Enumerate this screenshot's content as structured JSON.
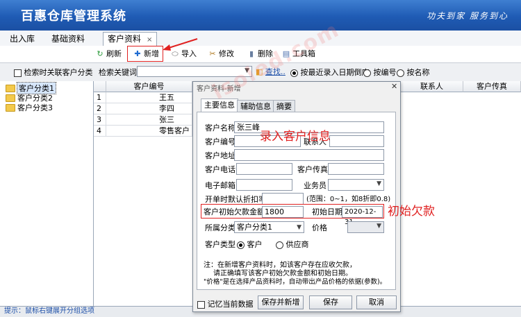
{
  "header": {
    "title": "百惠仓库管理系统",
    "slogan": "功夫到家 服务到心"
  },
  "tabs": [
    {
      "label": "出入库"
    },
    {
      "label": "基础资料"
    },
    {
      "label": "客户资料",
      "close": "×"
    }
  ],
  "toolbar": {
    "refresh": "刷新",
    "add": "新增",
    "import": "导入",
    "edit": "修改",
    "delete": "删除",
    "tools": "工具箱"
  },
  "search": {
    "related_check": "检索时关联客户分类",
    "keyword_label": "检索关键词",
    "keyword_value": "",
    "search_btn": "查找..",
    "sort_recent": "按最近录入日期倒序",
    "sort_code": "按编号",
    "sort_name": "按名称"
  },
  "tree": {
    "items": [
      "客户分类1",
      "客户分类2",
      "客户分类3"
    ]
  },
  "grid": {
    "headers": [
      "客户编号",
      "联系人",
      "客户传真"
    ],
    "rows": [
      {
        "num": "1",
        "name": "王五"
      },
      {
        "num": "2",
        "name": "李四"
      },
      {
        "num": "3",
        "name": "张三"
      },
      {
        "num": "4",
        "name": "零售客户"
      }
    ]
  },
  "status": {
    "text": "提示：鼠标右键展开分组选项"
  },
  "dialog": {
    "title": "客户资料-新增",
    "close": "✕",
    "tabs": [
      "主要信息",
      "辅助信息",
      "摘要"
    ],
    "fields": {
      "name_label": "客户名称",
      "name_value": "张三峰",
      "code_label": "客户编号",
      "code_value": "",
      "contact_label": "联系人",
      "contact_value": "",
      "address_label": "客户地址",
      "address_value": "",
      "phone_label": "客户电话",
      "phone_value": "",
      "fax_label": "客户传真",
      "fax_value": "",
      "email_label": "电子邮箱",
      "email_value": "",
      "salesman_label": "业务员",
      "salesman_value": "",
      "discount_label": "开单时默认折扣率",
      "discount_value": "",
      "discount_hint": "(范围：0~1，如8折即0.8)",
      "debt_label": "客户初始欠款金额",
      "debt_value": "1800",
      "date_label": "初始日期",
      "date_value": "2020-12-31",
      "category_label": "所属分类",
      "category_value": "客户分类1",
      "price_label": "价格",
      "price_value": "",
      "type_label": "客户类型",
      "type_customer": "客户",
      "type_supplier": "供应商"
    },
    "notes": [
      "注：在新增客户资料时，如该客户存在应收欠款，",
      "请正确填写该客户初始欠款金额和初始日期。",
      "\"价格\"是在选择产品资料时，自动带出产品价格的依据(参数)。"
    ],
    "remember": "记忆当前数据",
    "btn_save_new": "保存并新增",
    "btn_save": "保存",
    "btn_cancel": "取消"
  },
  "annotations": {
    "enter_info": "录入客户信息",
    "initial_debt": "初始欠款"
  },
  "watermark": "isoled.com",
  "colors": {
    "header_blue": "#1f5bb4",
    "annotation_red": "#e02020"
  }
}
